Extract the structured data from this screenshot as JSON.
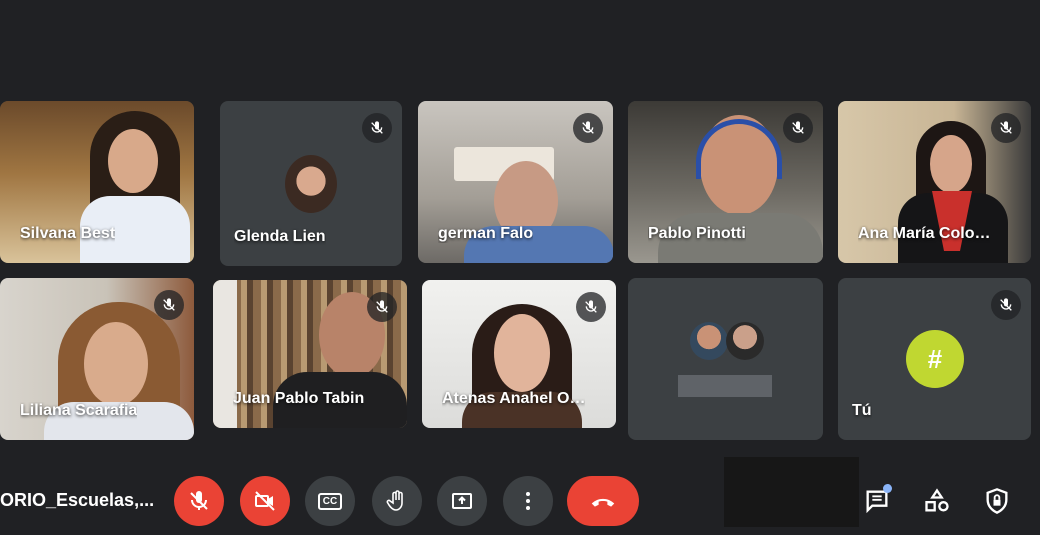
{
  "participants": [
    {
      "name": "Silvana Best",
      "muted": false
    },
    {
      "name": "Glenda Lien",
      "muted": true
    },
    {
      "name": "german Falo",
      "muted": true
    },
    {
      "name": "Pablo Pinotti",
      "muted": true
    },
    {
      "name": "Ana María Colo…",
      "muted": true
    },
    {
      "name": "Liliana Scarafia",
      "muted": true
    },
    {
      "name": "Juan Pablo Tabin",
      "muted": true
    },
    {
      "name": "Atenas Anahel O…",
      "muted": true
    },
    {
      "name": "",
      "muted": false
    },
    {
      "name": "Tú",
      "muted": true
    }
  ],
  "self_avatar_initial": "#",
  "meeting": {
    "title": "ORIO_Escuelas,..."
  },
  "colors": {
    "mic_off_red": "#ea4335",
    "self_avatar": "#c0d731",
    "notify_dot": "#8ab4f8"
  },
  "controls": {
    "mic": "mic-off-icon",
    "camera": "camera-off-icon",
    "captions_label": "CC",
    "raise_hand": "hand-icon",
    "present": "present-icon",
    "more": "more-vert-icon",
    "leave": "phone-hangup-icon"
  },
  "right_icons": [
    "chat-icon",
    "activities-icon",
    "host-controls-icon"
  ]
}
